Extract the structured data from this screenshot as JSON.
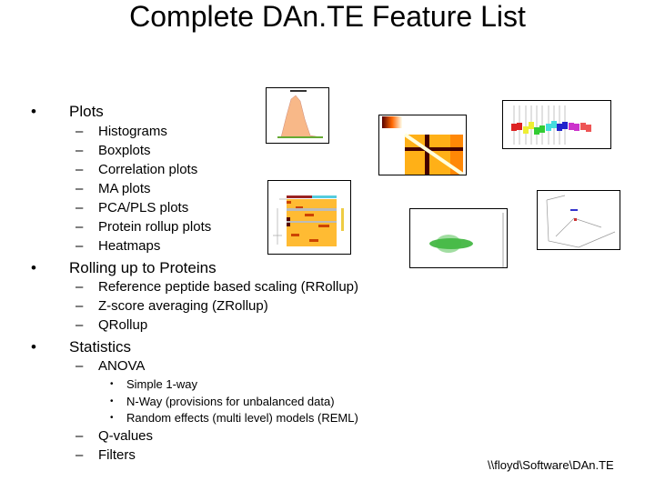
{
  "title": "Complete DAn.TE Feature List",
  "sections": [
    {
      "label": "Plots",
      "items": [
        "Histograms",
        "Boxplots",
        "Correlation plots",
        "MA plots",
        "PCA/PLS plots",
        "Protein rollup plots",
        "Heatmaps"
      ]
    },
    {
      "label": "Rolling up to Proteins",
      "items": [
        "Reference peptide based scaling (RRollup)",
        "Z-score averaging (ZRollup)",
        "QRollup"
      ]
    },
    {
      "label": "Statistics",
      "items": [
        "ANOVA",
        "Q-values",
        "Filters"
      ],
      "anova_subitems": [
        "Simple 1-way",
        "N-Way (provisions for unbalanced data)",
        "Random effects (multi level) models (REML)"
      ]
    }
  ],
  "bullet": "•",
  "dash": "–",
  "footer": "\\\\floyd\\Software\\DAn.TE",
  "thumbnails": [
    "histogram-thumbnail",
    "correlation-thumbnail",
    "boxplot-thumbnail",
    "heatmap-thumbnail",
    "ma-plot-thumbnail",
    "pca-thumbnail"
  ]
}
